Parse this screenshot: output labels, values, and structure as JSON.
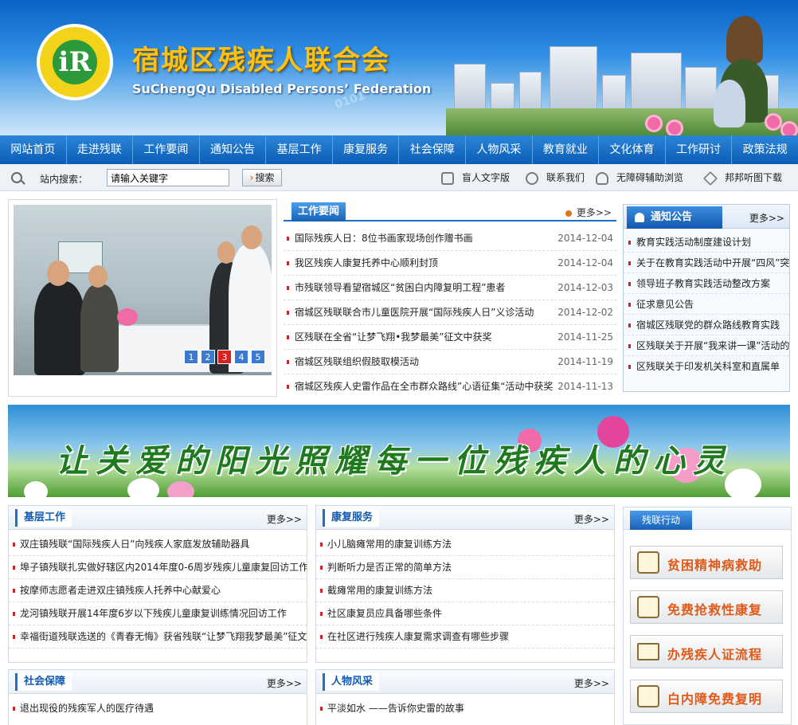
{
  "header": {
    "title": "宿城区残疾人联合会",
    "subtitle": "SuChengQu Disabled Persons’ Federation",
    "logo_glyph": "iR",
    "watermark": "0101"
  },
  "nav": {
    "items": [
      "网站首页",
      "走进残联",
      "工作要闻",
      "通知公告",
      "基层工作",
      "康复服务",
      "社会保障",
      "人物风采",
      "教育就业",
      "文化体育",
      "工作研讨",
      "政策法规"
    ]
  },
  "search": {
    "label": "站内搜索：",
    "value": "请输入关键字",
    "button": "搜索",
    "tools": [
      "盲人文字版",
      "联系我们",
      "无障碍辅助浏览",
      "邦邦听图下载"
    ]
  },
  "slider": {
    "pages": [
      "1",
      "2",
      "3",
      "4",
      "5"
    ],
    "active_page": "3"
  },
  "work_news": {
    "title": "工作要闻",
    "more": "更多>>",
    "items": [
      {
        "title": "国际残疾人日：8位书画家现场创作赠书画",
        "date": "2014-12-04"
      },
      {
        "title": "我区残疾人康复托养中心顺利封顶",
        "date": "2014-12-04"
      },
      {
        "title": "市残联领导看望宿城区“贫困白内障复明工程”患者",
        "date": "2014-12-03"
      },
      {
        "title": "宿城区残联联合市儿童医院开展“国际残疾人日”义诊活动",
        "date": "2014-12-02"
      },
      {
        "title": "区残联在全省“让梦飞翔•我梦最美”征文中获奖",
        "date": "2014-11-25"
      },
      {
        "title": "宿城区残联组织假肢取模活动",
        "date": "2014-11-19"
      },
      {
        "title": "宿城区残疾人史雷作品在全市群众路线”心语征集“活动中获奖",
        "date": "2014-11-13"
      }
    ]
  },
  "notice": {
    "title": "通知公告",
    "more": "更多>>",
    "items": [
      "教育实践活动制度建设计划",
      "关于在教育实践活动中开展“四风”突",
      "领导班子教育实践活动整改方案",
      "征求意见公告",
      "宿城区残联党的群众路线教育实践",
      "区残联关于开展“我来讲一课”活动的",
      "区残联关于印发机关科室和直属单"
    ]
  },
  "banner": {
    "text": "让关爱的阳光照耀每一位残疾人的心灵"
  },
  "sections": {
    "jiceng": {
      "title": "基层工作",
      "more": "更多>>",
      "items": [
        "双庄镇残联“国际残疾人日”向残疾人家庭发放辅助器具",
        "埠子镇残联扎实做好辖区内2014年度0-6周岁残疾儿童康复回访工作",
        "按摩师志愿者走进双庄镇残疾人托养中心献爱心",
        "龙河镇残联开展14年度6岁以下残疾儿童康复训练情况回访工作",
        "幸福街道残联选送的《青春无悔》获省残联“让梦飞翔我梦最美”征文"
      ]
    },
    "kangfu": {
      "title": "康复服务",
      "more": "更多>>",
      "items": [
        "小儿脑瘫常用的康复训练方法",
        "判断听力是否正常的简单方法",
        "截瘫常用的康复训练方法",
        "社区康复员应具备哪些条件",
        "在社区进行残疾人康复需求调查有哪些步骤"
      ]
    },
    "shehui": {
      "title": "社会保障",
      "more": "更多>>",
      "items": [
        "退出现役的残疾军人的医疗待遇"
      ]
    },
    "renwu": {
      "title": "人物风采",
      "more": "更多>>",
      "items": [
        "平淡如水 ——告诉你史雷的故事"
      ]
    }
  },
  "side_actions": {
    "title": "残联行动",
    "items": [
      "贫困精神病救助",
      "免费抢救性康复",
      "办残疾人证流程",
      "白内障免费复明"
    ]
  },
  "colors": {
    "primary": "#1562b8",
    "accent": "#e0761a",
    "title_gold": "#f8c21a",
    "banner_green": "#1f7a1f"
  }
}
